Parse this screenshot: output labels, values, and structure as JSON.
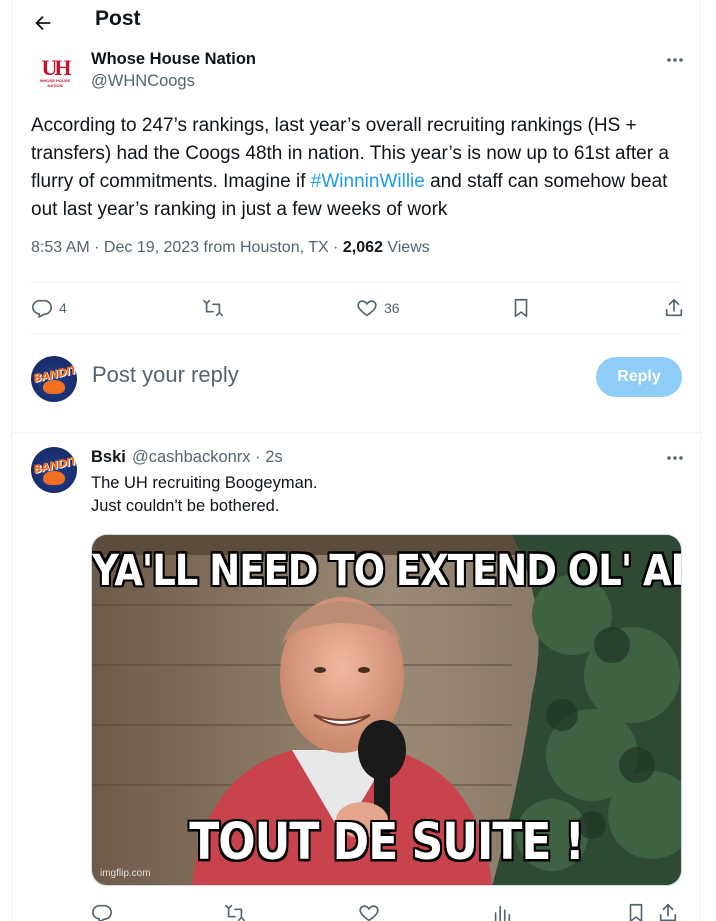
{
  "header": {
    "title": "Post"
  },
  "post": {
    "author_name": "Whose House Nation",
    "author_handle": "@WHNCoogs",
    "avatar_logo_text": "UH",
    "avatar_sub_text": "WHOSE HOUSE NATION",
    "text_before": "According to 247’s rankings, last year’s overall recruiting rankings (HS + transfers) had the Coogs 48th in nation. This year’s is now up to 61st after a flurry of commitments. Imagine if ",
    "hashtag": "#WinninWillie",
    "text_after": " and staff can somehow beat out last year’s ranking in just a few weeks of work",
    "meta_time": "8:53 AM · Dec 19, 2023 from Houston, TX · ",
    "views_count": "2,062",
    "views_label": " Views",
    "replies": "4",
    "likes": "36"
  },
  "compose": {
    "placeholder": "Post your reply",
    "reply_button": "Reply",
    "avatar_text": "BANDITS"
  },
  "reply": {
    "author_name": "Bski",
    "author_handle": "@cashbackonrx · 2s",
    "text_line1": "The UH recruiting Boogeyman.",
    "text_line2": "Just couldn't be bothered.",
    "avatar_text": "BANDITS",
    "meme_top": "YA'LL NEED TO EXTEND OL' ARANDA",
    "meme_bottom": "TOUT DE SUITE !",
    "meme_watermark": "imgflip.com"
  },
  "colors": {
    "accent": "#1d9bf0",
    "reply_button": "#8ecdf7",
    "muted_text": "#536471",
    "uh_red": "#c8102e",
    "bandits_orange": "#f36f21",
    "bandits_blue": "#1a2f70"
  }
}
